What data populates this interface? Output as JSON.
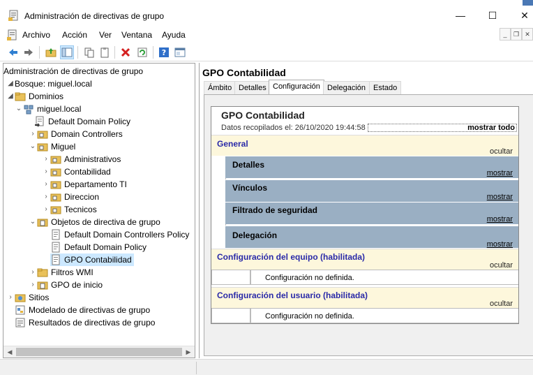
{
  "window": {
    "title": "Administración de directivas de grupo",
    "controls": {
      "minimize": "—",
      "maximize": "☐",
      "close": "✕"
    }
  },
  "menubar": {
    "items": [
      "Archivo",
      "Acción",
      "Ver",
      "Ventana",
      "Ayuda"
    ]
  },
  "toolbar": {
    "icons": [
      "back-icon",
      "forward-icon",
      "up-folder-icon",
      "show-hide-tree-icon",
      "copy-icon",
      "paste-icon",
      "delete-icon",
      "refresh-icon",
      "help-icon",
      "properties-icon"
    ]
  },
  "tree": {
    "root": "Administración de directivas de grupo",
    "forest": "Bosque: miguel.local",
    "domains": "Dominios",
    "domain": "miguel.local",
    "default_domain_policy": "Default Domain Policy",
    "domain_controllers": "Domain Controllers",
    "ou_miguel": "Miguel",
    "ou_children": [
      "Administrativos",
      "Contabilidad",
      "Departamento TI",
      "Direccion",
      "Tecnicos"
    ],
    "gpo_container": "Objetos de directiva de grupo",
    "gpos": [
      "Default Domain Controllers Policy",
      "Default Domain Policy",
      "GPO Contabilidad"
    ],
    "wmi_filters": "Filtros WMI",
    "starter_gpos": "GPO de inicio",
    "sites": "Sitios",
    "modeling": "Modelado de directivas de grupo",
    "results": "Resultados de directivas de grupo"
  },
  "details": {
    "title": "GPO Contabilidad",
    "tabs": [
      "Ámbito",
      "Detalles",
      "Configuración",
      "Delegación",
      "Estado"
    ],
    "active_tab": "Configuración",
    "report": {
      "title": "GPO Contabilidad",
      "collected": "Datos recopilados el: 26/10/2020 19:44:58",
      "show_all": "mostrar todo",
      "general": {
        "label": "General",
        "action": "ocultar"
      },
      "sections": [
        {
          "label": "Detalles",
          "action": "mostrar"
        },
        {
          "label": "Vínculos",
          "action": "mostrar"
        },
        {
          "label": "Filtrado de seguridad",
          "action": "mostrar"
        },
        {
          "label": "Delegación",
          "action": "mostrar"
        }
      ],
      "computer": {
        "label": "Configuración del equipo (habilitada)",
        "action": "ocultar",
        "note": "Configuración no definida."
      },
      "user": {
        "label": "Configuración del usuario (habilitada)",
        "action": "ocultar",
        "note": "Configuración no definida."
      }
    }
  },
  "colors": {
    "section_yellow": "#fdf7dc",
    "section_blue": "#9aafc3",
    "header_text_blue": "#2a2aa8",
    "selection": "#cce8ff"
  }
}
